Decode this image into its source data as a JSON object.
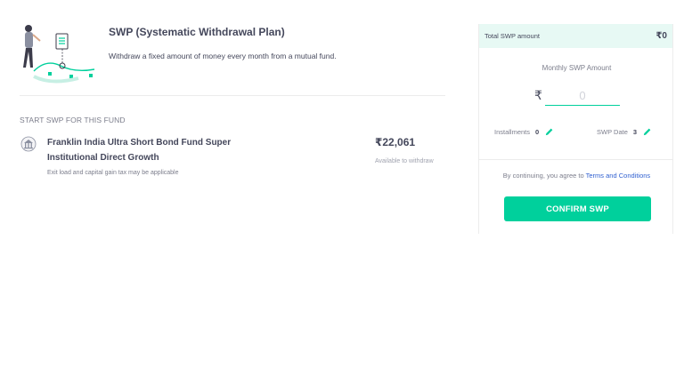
{
  "intro": {
    "title": "SWP (Systematic Withdrawal Plan)",
    "description": "Withdraw a fixed amount of money every month from a mutual fund."
  },
  "section": {
    "label": "START SWP FOR THIS FUND"
  },
  "fund": {
    "name": "Franklin India Ultra Short Bond Fund Super Institutional Direct Growth",
    "note": "Exit load and capital gain tax may be applicable",
    "amount": "₹22,061",
    "amount_caption": "Available to withdraw",
    "logo_icon": "temple-logo-icon"
  },
  "panel": {
    "total_label": "Total SWP amount",
    "total_value": "₹0",
    "monthly_label": "Monthly SWP Amount",
    "currency_symbol": "₹",
    "amount_placeholder": "0",
    "installments_label": "Installments",
    "installments_value": "0",
    "swp_date_label": "SWP Date",
    "swp_date_value": "3",
    "terms_prefix": "By continuing, you agree to ",
    "terms_link": "Terms and Conditions",
    "confirm_label": "CONFIRM SWP"
  },
  "colors": {
    "accent": "#00d09c",
    "header_bg": "#e7f9f4",
    "link": "#2f5fd0",
    "text": "#44475b"
  }
}
